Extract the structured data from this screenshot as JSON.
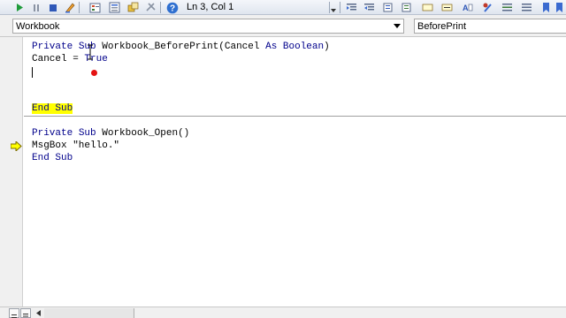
{
  "toolbar": {
    "buttons": [
      "run-icon",
      "pause-icon",
      "stop-icon",
      "design-mode-icon",
      "project-explorer-icon",
      "properties-icon",
      "object-browser-icon",
      "toolbox-icon",
      "help-icon"
    ],
    "cursor_position": "Ln 3, Col 1"
  },
  "object_dropdown": {
    "value": "Workbook"
  },
  "procedure_dropdown": {
    "value": "BeforePrint"
  },
  "code": {
    "proc1": {
      "private": "Private",
      "sub": "Sub",
      "signature_start": "Workbook_BeforePrint(Cancel",
      "as": "As",
      "boolean": "Boolean",
      "close_paren": ")",
      "body_line": "Cancel = ",
      "true_kw": "True",
      "end_sub": "End Sub"
    },
    "proc2": {
      "private": "Private",
      "sub": "Sub",
      "name": "Workbook_Open()",
      "msgbox_line": "MsgBox \"hello.\"",
      "end_sub": "End Sub"
    }
  },
  "colors": {
    "keyword": "#00008b",
    "execution_highlight": "#ffff00",
    "breakpoint_dot": "#e41313"
  }
}
